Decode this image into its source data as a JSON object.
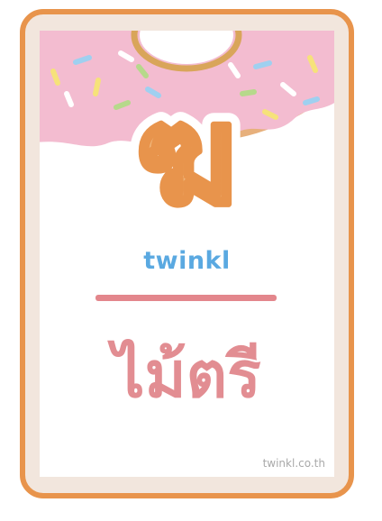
{
  "card": {
    "thai_letter": "ฆ",
    "brand": "twinkl",
    "thai_word": "ไม้ตรี",
    "website": "twinkl.co.th"
  },
  "colors": {
    "frame": "#e8944c",
    "frame_fill": "#f2e6dd",
    "donut_icing": "#f3bcd0",
    "letter_fill": "#f0b77b",
    "letter_outline": "#e8944c",
    "divider": "#e3868c",
    "word": "#e28d92",
    "brand": "#5aa9e1"
  },
  "icons": [
    "donut-icon"
  ]
}
